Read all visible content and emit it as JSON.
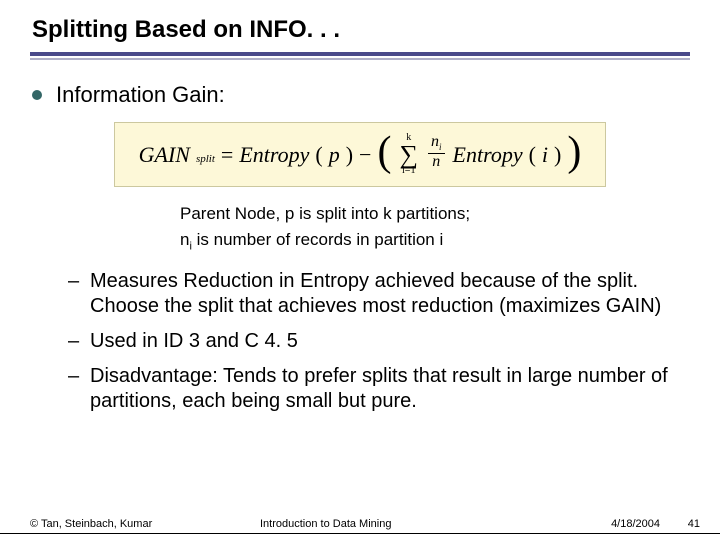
{
  "title": "Splitting Based on INFO. . .",
  "bullet": "Information Gain:",
  "formula": {
    "lhs": "GAIN",
    "lhs_sub": "split",
    "eq": "=",
    "entropy_p": "Entropy",
    "p_arg": "p",
    "minus": "−",
    "sum_top": "k",
    "sum_bottom": "i=1",
    "frac_num": "n",
    "frac_num_sub": "i",
    "frac_den": "n",
    "entropy_i": "Entropy",
    "i_arg": "i"
  },
  "notes": {
    "line1": "Parent Node, p is split into k partitions;",
    "line2_pre": "n",
    "line2_sub": "i",
    "line2_post": " is number of records in partition i"
  },
  "dashes": [
    "Measures Reduction in Entropy achieved because of the split. Choose the split that achieves most reduction (maximizes GAIN)",
    "Used in ID 3 and C 4. 5",
    "Disadvantage: Tends to prefer splits that result in large number of partitions, each being small but pure."
  ],
  "footer": {
    "left": "© Tan, Steinbach, Kumar",
    "center": "Introduction to Data Mining",
    "date": "4/18/2004",
    "page": "41"
  }
}
